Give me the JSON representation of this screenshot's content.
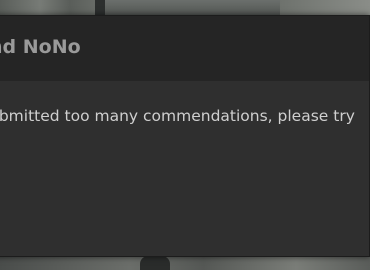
{
  "dialog": {
    "title": "nd NoNo",
    "message": "ubmitted too many commendations, please try"
  }
}
